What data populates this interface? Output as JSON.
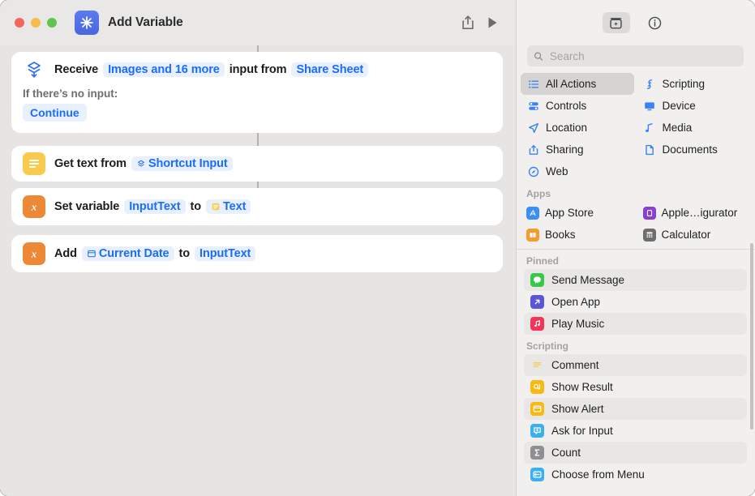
{
  "window": {
    "title": "Add Variable",
    "app_icon": "shortcuts-sparkle-icon",
    "traffic_lights": [
      "close",
      "minimize",
      "zoom"
    ],
    "toolbar": {
      "share_label": "share-icon",
      "run_label": "run-icon"
    }
  },
  "canvas": {
    "actions": [
      {
        "icon": "receive-input-icon",
        "icon_style": "plain-blue",
        "parts": [
          {
            "type": "text",
            "value": "Receive"
          },
          {
            "type": "token",
            "value": "Images and 16 more"
          },
          {
            "type": "text",
            "value": "input from"
          },
          {
            "type": "token",
            "value": "Share Sheet"
          }
        ],
        "sub_label": "If there’s no input:",
        "sub_token": "Continue"
      },
      {
        "icon": "text-lines-icon",
        "icon_style": "yellow",
        "parts": [
          {
            "type": "text",
            "value": "Get text from"
          },
          {
            "type": "token",
            "value": "Shortcut Input",
            "glyph": "shortcut-input-icon"
          }
        ]
      },
      {
        "icon": "variable-x-icon",
        "icon_style": "orange",
        "parts": [
          {
            "type": "text",
            "value": "Set variable"
          },
          {
            "type": "token",
            "value": "InputText"
          },
          {
            "type": "text",
            "value": "to"
          },
          {
            "type": "token",
            "value": "Text",
            "glyph": "text-token-icon"
          }
        ]
      },
      {
        "icon": "variable-x-icon",
        "icon_style": "orange",
        "parts": [
          {
            "type": "text",
            "value": "Add"
          },
          {
            "type": "token",
            "value": "Current Date",
            "glyph": "calendar-icon"
          },
          {
            "type": "text",
            "value": "to"
          },
          {
            "type": "token",
            "value": "InputText"
          }
        ]
      }
    ]
  },
  "sidebar": {
    "toolbar": {
      "action_library_label": "action-library-icon",
      "info_label": "info-icon"
    },
    "search": {
      "placeholder": "Search",
      "value": "",
      "icon": "search-icon"
    },
    "categories": [
      {
        "label": "All Actions",
        "icon": "list-bullet-icon",
        "selected": true
      },
      {
        "label": "Scripting",
        "icon": "scripting-icon",
        "selected": false
      },
      {
        "label": "Controls",
        "icon": "controls-icon",
        "selected": false
      },
      {
        "label": "Device",
        "icon": "display-icon",
        "selected": false
      },
      {
        "label": "Location",
        "icon": "location-arrow-icon",
        "selected": false
      },
      {
        "label": "Media",
        "icon": "music-note-icon",
        "selected": false
      },
      {
        "label": "Sharing",
        "icon": "share-up-icon",
        "selected": false
      },
      {
        "label": "Documents",
        "icon": "document-icon",
        "selected": false
      },
      {
        "label": "Web",
        "icon": "compass-icon",
        "selected": false
      }
    ],
    "apps_section": {
      "header": "Apps",
      "items": [
        {
          "label": "App Store",
          "icon": "app-store-icon",
          "color": "#3a8ef6"
        },
        {
          "label": "Apple…igurator",
          "icon": "apple-configurator-icon",
          "color": "#8a3fd1"
        },
        {
          "label": "Books",
          "icon": "books-icon",
          "color": "#f79b2c"
        },
        {
          "label": "Calculator",
          "icon": "calculator-icon",
          "color": "#6e6e6e"
        }
      ]
    },
    "pinned_section": {
      "header": "Pinned",
      "items": [
        {
          "label": "Send Message",
          "icon": "message-bubble-icon",
          "color": "#37c84a",
          "stripe": true
        },
        {
          "label": "Open App",
          "icon": "open-app-arrow-icon",
          "color": "#5856d6",
          "stripe": false
        },
        {
          "label": "Play Music",
          "icon": "music-note-icon",
          "color": "#f5345a",
          "stripe": true
        }
      ]
    },
    "scripting_section": {
      "header": "Scripting",
      "items": [
        {
          "label": "Comment",
          "icon": "comment-lines-icon",
          "color": "#f8ca4d",
          "stripe": true
        },
        {
          "label": "Show Result",
          "icon": "show-result-icon",
          "color": "#f9b911",
          "stripe": false
        },
        {
          "label": "Show Alert",
          "icon": "show-alert-icon",
          "color": "#f9b911",
          "stripe": true
        },
        {
          "label": "Ask for Input",
          "icon": "ask-input-icon",
          "color": "#3ab0f3",
          "stripe": false
        },
        {
          "label": "Count",
          "icon": "count-sigma-icon",
          "color": "#8e8e93",
          "stripe": true
        },
        {
          "label": "Choose from Menu",
          "icon": "choose-menu-icon",
          "color": "#3ab0f3",
          "stripe": false
        }
      ]
    }
  }
}
